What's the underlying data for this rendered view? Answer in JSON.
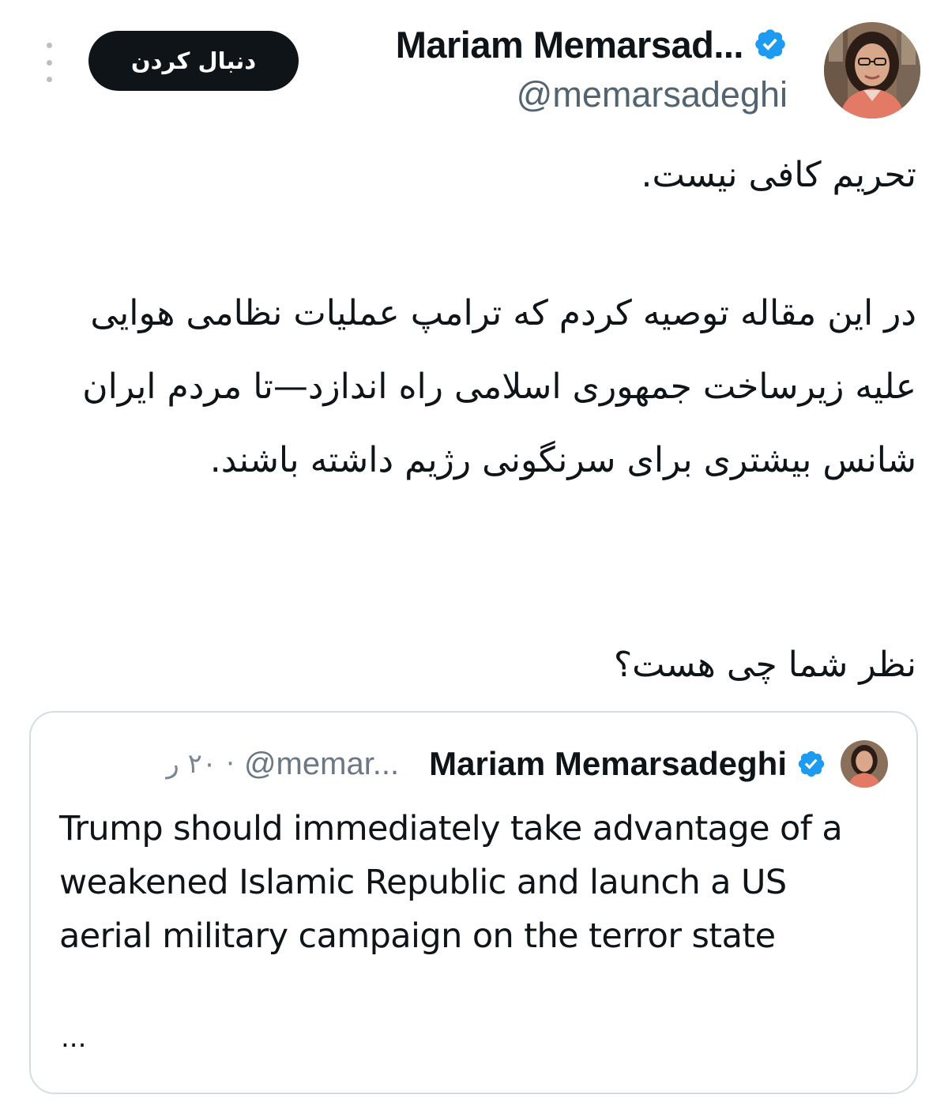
{
  "header": {
    "follow_label": "دنبال کردن",
    "author_name": "Mariam Memarsad...",
    "author_handle": "@memarsadeghi"
  },
  "tweet": {
    "paragraphs": [
      "تحریم کافی نیست.",
      "در این مقاله توصیه کردم که ترامپ عملیات نظامی هوایی علیه زیرساخت جمهوری اسلامی راه اندازد—تا مردم ایران شانس بیشتری برای سرنگونی رژیم داشته باشند.",
      "نظر شما چی هست؟"
    ]
  },
  "quoted_tweet": {
    "name": "Mariam Memarsadeghi",
    "handle": "@memar...",
    "separator": "·",
    "time": "۲۰ ر",
    "text": "Trump should immediately take advantage of a weakened Islamic Republic and launch a US aerial military campaign on the terror state",
    "ellipsis": "..."
  },
  "colors": {
    "verified_blue": "#1d9bf0",
    "follow_button_bg": "#0f1419",
    "text_primary": "#0f1419",
    "text_secondary": "#536471",
    "card_border": "#d6dde2"
  },
  "icons": {
    "more": "more-vertical-icon",
    "verified": "verified-badge-icon"
  }
}
